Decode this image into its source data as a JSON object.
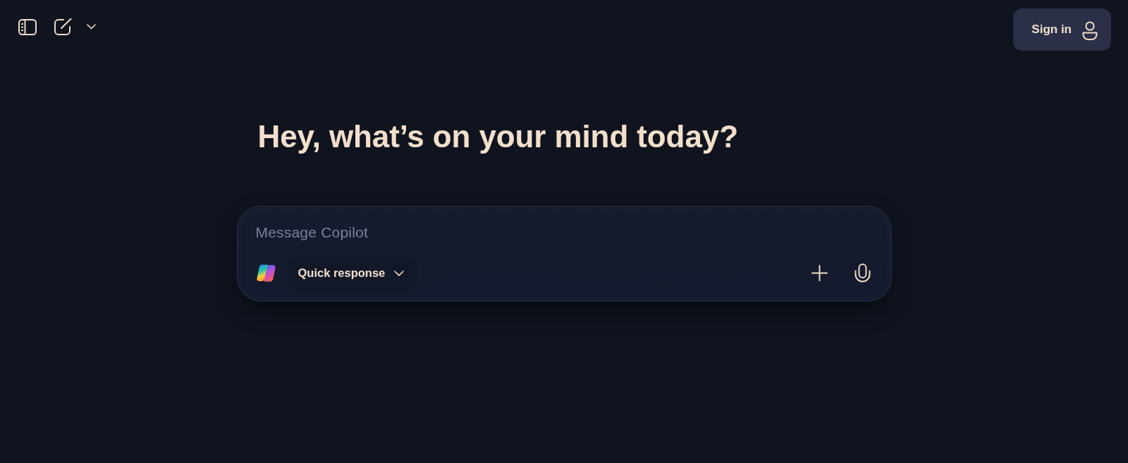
{
  "header": {
    "sign_in": {
      "label": "Sign in"
    }
  },
  "greeting": "Hey, what’s on your mind today?",
  "composer": {
    "placeholder": "Message Copilot",
    "mode_dropdown": {
      "label": "Quick response"
    }
  }
}
